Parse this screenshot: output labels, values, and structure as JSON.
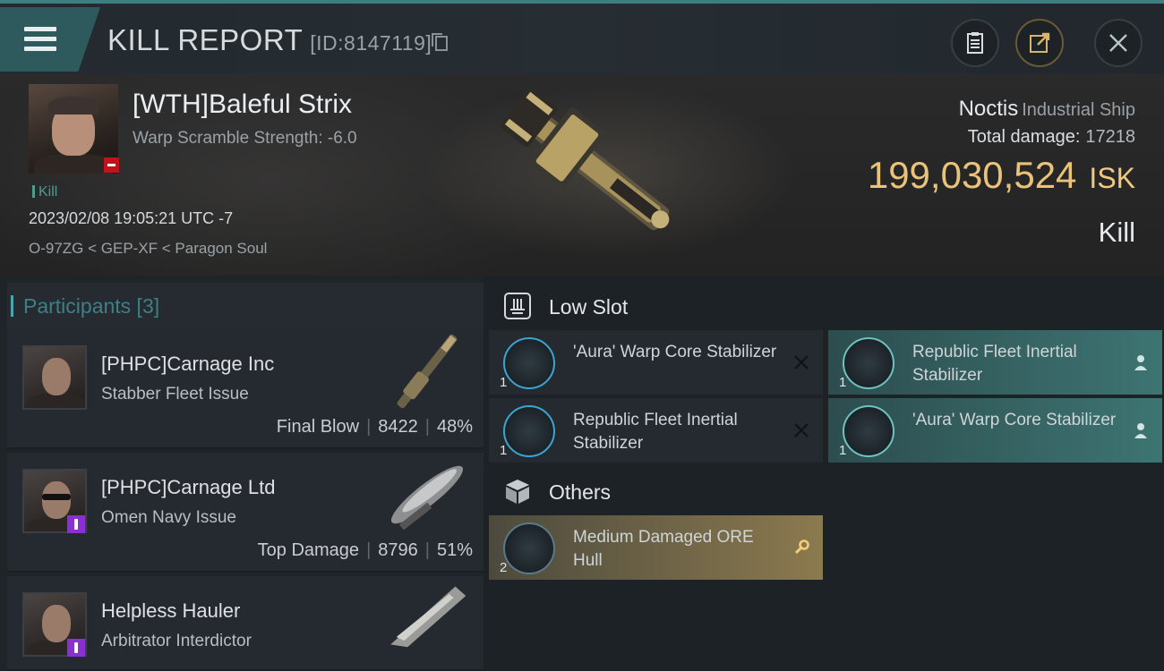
{
  "header": {
    "title": "KILL REPORT",
    "id_label": "[ID:8147119]"
  },
  "victim": {
    "name": "[WTH]Baleful Strix",
    "warp_scramble": "Warp Scramble Strength: -6.0",
    "kill_tag": "Kill",
    "datetime": "2023/02/08 19:05:21 UTC -7",
    "location": "O-97ZG < GEP-XF < Paragon Soul",
    "ship_name": "Noctis",
    "ship_class": "Industrial Ship",
    "total_damage_label": "Total damage:",
    "total_damage_value": "17218",
    "isk_value": "199,030,524",
    "isk_unit": "ISK",
    "result": "Kill"
  },
  "participants": {
    "header": "Participants [3]",
    "items": [
      {
        "name": "[PHPC]Carnage Inc",
        "ship": "Stabber Fleet Issue",
        "role": "Final Blow",
        "damage": "8422",
        "percent": "48%"
      },
      {
        "name": "[PHPC]Carnage Ltd",
        "ship": "Omen Navy Issue",
        "role": "Top Damage",
        "damage": "8796",
        "percent": "51%"
      },
      {
        "name": "Helpless Hauler",
        "ship": "Arbitrator Interdictor"
      }
    ]
  },
  "fittings": {
    "low_slot_label": "Low Slot",
    "others_label": "Others",
    "low_slot": [
      {
        "name": "'Aura' Warp Core Stabilizer",
        "qty": "1",
        "state": "destroyed"
      },
      {
        "name": "Republic Fleet Inertial Stabilizer",
        "qty": "1",
        "state": "dropped"
      },
      {
        "name": "Republic Fleet Inertial Stabilizer",
        "qty": "1",
        "state": "destroyed"
      },
      {
        "name": "'Aura' Warp Core Stabilizer",
        "qty": "1",
        "state": "dropped"
      }
    ],
    "others": [
      {
        "name": "Medium Damaged ORE Hull",
        "qty": "2",
        "state": "salvage"
      }
    ]
  },
  "colors": {
    "accent_teal": "#3d7f80",
    "isk_gold": "#e9c37a",
    "dropped_teal": "#3d7472",
    "salvage_gold": "#8c7a4f"
  },
  "icons": [
    "menu-icon",
    "clipboard-icon",
    "share-icon",
    "close-icon",
    "low-slot-icon",
    "cargo-box-icon",
    "destroyed-x-icon",
    "pilot-icon",
    "wrench-icon"
  ]
}
